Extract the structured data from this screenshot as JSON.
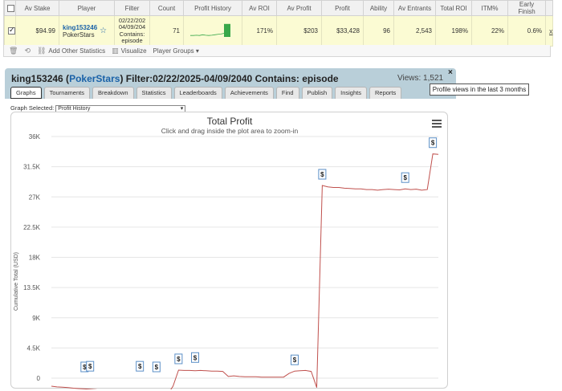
{
  "stats_table": {
    "headers": [
      "Av Stake",
      "Player",
      "Filter",
      "Count",
      "Profit History",
      "Av ROI",
      "Av Profit",
      "Profit",
      "Ability",
      "Av Entrants",
      "Total ROI",
      "ITM%",
      "Early Finish"
    ],
    "row": {
      "av_stake": "$94.99",
      "player_name": "king153246",
      "player_site": "PokerStars",
      "filter_lines": [
        "02/22/202",
        "04/09/204",
        "Contains:",
        "episode"
      ],
      "count": "71",
      "av_roi": "171%",
      "av_profit": "$203",
      "profit": "$33,428",
      "ability": "96",
      "av_entrants": "2,543",
      "total_roi": "198%",
      "itm": "22%",
      "early_finish": "0.6%",
      "remove_label": "x"
    }
  },
  "toolbar": {
    "add_stats_label": "Add Other Statistics",
    "visualize_label": "Visualize",
    "player_groups_label": "Player Groups ▾"
  },
  "panel": {
    "player": "king153246",
    "site": "PokerStars",
    "filter_text": "Filter:02/22/2025-04/09/2040 Contains: episode",
    "views": "Views: 1,521",
    "close": "×",
    "tooltip": "Profile views in the last 3 months",
    "tabs": [
      "Graphs",
      "Tournaments",
      "Breakdown",
      "Statistics",
      "Leaderboards",
      "Achievements",
      "Find",
      "Publish",
      "Insights",
      "Reports"
    ],
    "active_tab": 0,
    "graph_selected_label": "Graph Selected:",
    "graph_selected_value": "Profit History"
  },
  "chart_data": {
    "type": "line",
    "title": "Total Profit",
    "subtitle": "Click and drag inside the plot area to zoom-in",
    "ylabel": "Cumulative Total (USD)",
    "ylim": [
      -500,
      36000
    ],
    "y_ticks": [
      0,
      4500,
      9000,
      13500,
      18000,
      22500,
      27000,
      31500,
      36000
    ],
    "y_tick_labels": [
      "0",
      "4.5K",
      "9K",
      "13.5K",
      "18K",
      "22.5K",
      "27K",
      "31.5K",
      "36K"
    ],
    "x": [
      0,
      1,
      2,
      3,
      4,
      5,
      6,
      7,
      8,
      9,
      10,
      11,
      12,
      13,
      14,
      15,
      16,
      17,
      18,
      19,
      20,
      21,
      22,
      23,
      24,
      25,
      26,
      27,
      28,
      29,
      30,
      31,
      32,
      33,
      34,
      35,
      36,
      37,
      38,
      39,
      40,
      41,
      42,
      43,
      44,
      45,
      46,
      47,
      48,
      49,
      50,
      51,
      52,
      53,
      54,
      55,
      56,
      57,
      58,
      59,
      60,
      61,
      62,
      63,
      64,
      65,
      66,
      67,
      68,
      69,
      70
    ],
    "values": [
      -1200,
      -1300,
      -1350,
      -1400,
      -1500,
      -1550,
      -1600,
      -1650,
      -1700,
      -1800,
      -1850,
      -1900,
      -1950,
      -2000,
      -2050,
      -2100,
      -2150,
      -2200,
      -2300,
      -2350,
      -2400,
      -2450,
      -1200,
      1200,
      1150,
      1150,
      1100,
      1150,
      1100,
      1050,
      1050,
      1000,
      250,
      350,
      250,
      200,
      200,
      200,
      150,
      150,
      150,
      150,
      150,
      700,
      1050,
      1100,
      1150,
      1000,
      -1400,
      28700,
      28500,
      28400,
      28400,
      28300,
      28250,
      28200,
      28200,
      28100,
      28100,
      28000,
      28100,
      28150,
      28100,
      28050,
      28200,
      28100,
      28150,
      28000,
      28100,
      33400,
      33350
    ],
    "markers": [
      {
        "x": 6,
        "y": 0,
        "label": "$"
      },
      {
        "x": 7,
        "y": 100,
        "label": "$"
      },
      {
        "x": 16,
        "y": 100,
        "label": "$"
      },
      {
        "x": 19,
        "y": 0,
        "label": "$"
      },
      {
        "x": 23,
        "y": 1200,
        "label": "$"
      },
      {
        "x": 26,
        "y": 1400,
        "label": "$"
      },
      {
        "x": 44,
        "y": 1050,
        "label": "$"
      },
      {
        "x": 49,
        "y": 28700,
        "label": "$"
      },
      {
        "x": 64,
        "y": 28200,
        "label": "$"
      },
      {
        "x": 69,
        "y": 33400,
        "label": "$"
      }
    ],
    "line_color": "#c0504d",
    "grid": true
  },
  "sparkline": {
    "values": [
      0.1,
      0.1,
      0.12,
      0.1,
      0.15,
      0.12,
      0.1,
      0.12,
      0.15,
      0.18,
      0.2,
      0.25,
      0.9
    ],
    "color": "#39a84a"
  }
}
